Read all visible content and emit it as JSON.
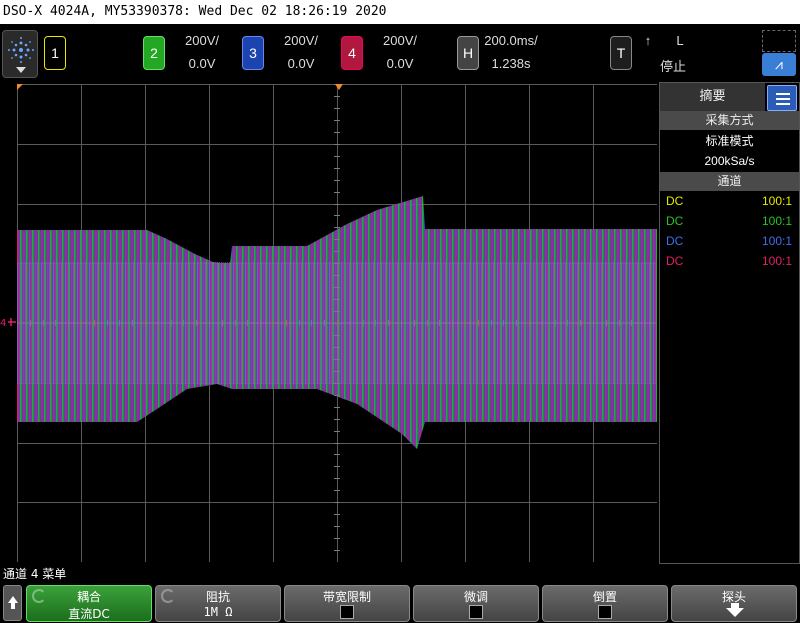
{
  "title": "DSO-X 4024A, MY53390378: Wed Dec 02 18:26:19 2020",
  "channels": [
    {
      "num": "1",
      "color": "#e8e800"
    },
    {
      "num": "2",
      "scale": "200V/",
      "offset": "0.0V",
      "color": "#22c622"
    },
    {
      "num": "3",
      "scale": "200V/",
      "offset": "0.0V",
      "color": "#2c5ee0"
    },
    {
      "num": "4",
      "scale": "200V/",
      "offset": "0.0V",
      "color": "#e0206a"
    }
  ],
  "horizontal": {
    "label": "H",
    "scale": "200.0ms/",
    "position": "1.238s"
  },
  "trigger": {
    "label": "T",
    "slope": "↑",
    "source": "L",
    "state": "停止"
  },
  "sidebar": {
    "header": "摘要",
    "acq_title": "采集方式",
    "acq_mode": "标准模式",
    "sample_rate": "200kSa/s",
    "chan_title": "通道",
    "rows": [
      {
        "coupling": "DC",
        "probe": "100:1",
        "color": "#e8e800"
      },
      {
        "coupling": "DC",
        "probe": "100:1",
        "color": "#22c622"
      },
      {
        "coupling": "DC",
        "probe": "100:1",
        "color": "#2c5ee0"
      },
      {
        "coupling": "DC",
        "probe": "100:1",
        "color": "#e0206a"
      }
    ]
  },
  "status_line": "通道 4 菜单",
  "softkeys": [
    {
      "title": "耦合",
      "value": "直流DC"
    },
    {
      "title": "阻抗",
      "value": "1M Ω"
    },
    {
      "title": "带宽限制"
    },
    {
      "title": "微调"
    },
    {
      "title": "倒置"
    },
    {
      "title": "探头"
    }
  ]
}
